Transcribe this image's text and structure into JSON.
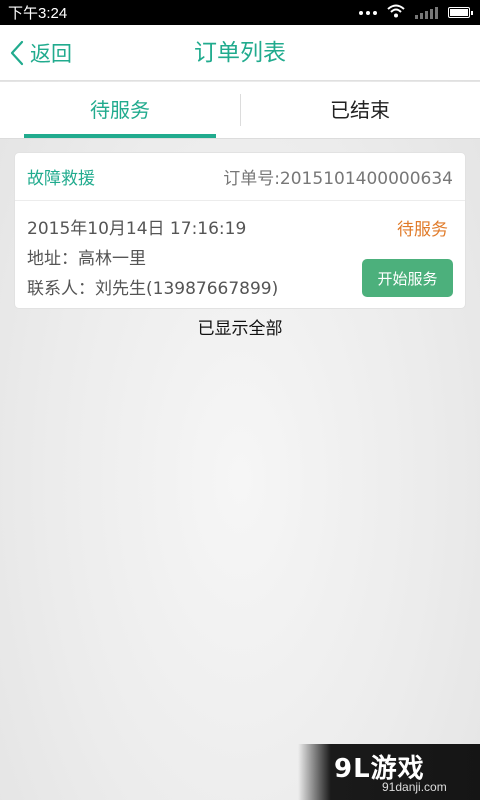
{
  "status_bar": {
    "time": "下午3:24"
  },
  "nav": {
    "back_label": "返回",
    "title": "订单列表"
  },
  "tabs": [
    {
      "label": "待服务",
      "active": true
    },
    {
      "label": "已结束",
      "active": false
    }
  ],
  "order": {
    "service_type": "故障救援",
    "order_number": "订单号:2015101400000634",
    "datetime": "2015年10月14日  17:16:19",
    "address": "地址：高林一里",
    "contact": "联系人：刘先生(13987667899)",
    "status": "待服务",
    "action_label": "开始服务"
  },
  "list_footer": "已显示全部",
  "watermark": {
    "brand": "9L游戏",
    "site": "91danji.com"
  },
  "colors": {
    "accent": "#21ab8e",
    "status_pending": "#e07b2a",
    "button": "#4cb07c"
  }
}
